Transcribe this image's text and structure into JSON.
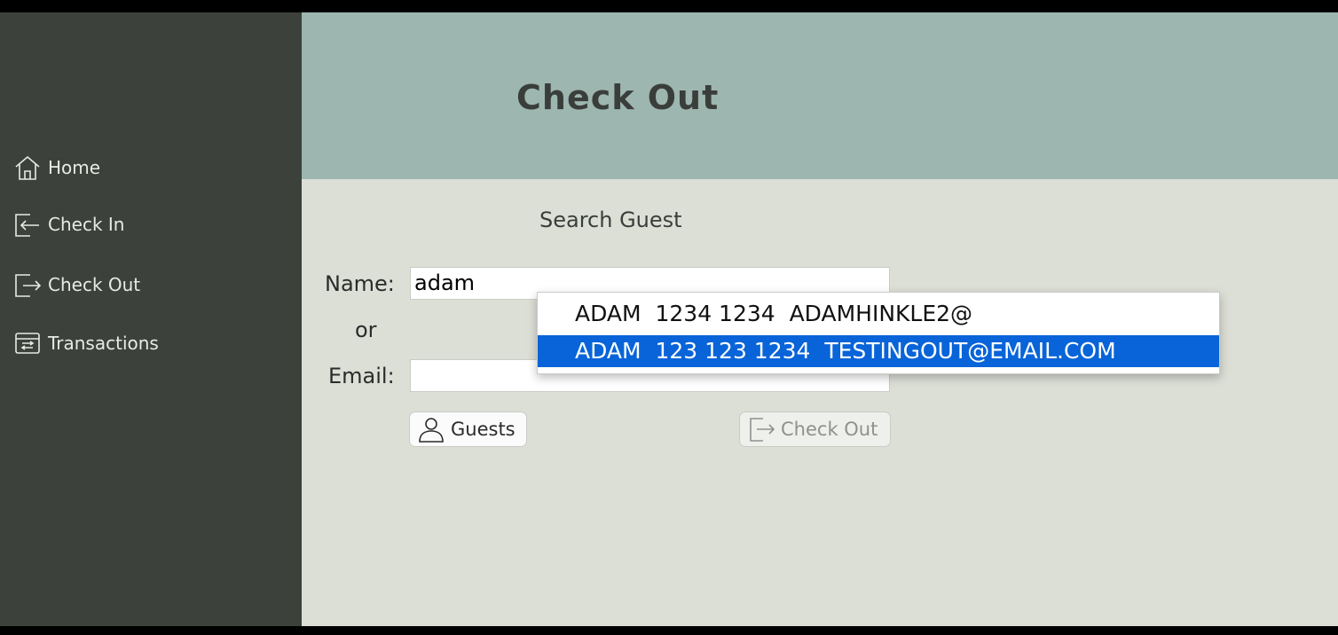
{
  "sidebar": {
    "items": [
      {
        "label": "Home",
        "icon": "home-icon"
      },
      {
        "label": "Check In",
        "icon": "check-in-icon"
      },
      {
        "label": "Check Out",
        "icon": "check-out-icon"
      },
      {
        "label": "Transactions",
        "icon": "transactions-icon"
      }
    ]
  },
  "header": {
    "title": "Check Out"
  },
  "form": {
    "section_title": "Search Guest",
    "name_label": "Name:",
    "name_value": "adam",
    "or_label": "or",
    "email_label": "Email:",
    "email_value": "",
    "guests_button": "Guests",
    "checkout_button": "Check Out"
  },
  "autocomplete": {
    "suggestions": [
      "ADAM  1234 1234  ADAMHINKLE2@",
      "ADAM  123 123 1234  TESTINGOUT@EMAIL.COM"
    ],
    "selected_index": 1
  },
  "colors": {
    "sidebar": "#3c413c",
    "header": "#9db6b0",
    "content": "#dcdfd6",
    "selection": "#0864d8"
  }
}
